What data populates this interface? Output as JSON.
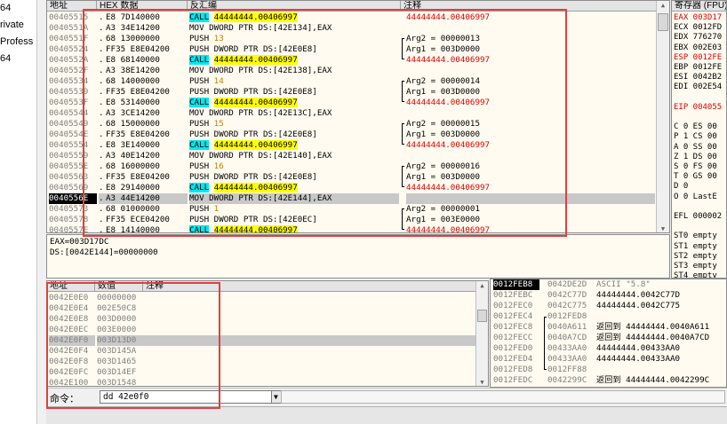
{
  "left_items": [
    "64",
    "rivate",
    "Profess",
    "64"
  ],
  "cpu_headers": {
    "address": "地址",
    "hex": "HEX 数据",
    "disasm": "反汇编",
    "comment": "注释"
  },
  "cpu_rows": [
    {
      "addr": "00405515",
      "dot": ".",
      "hex": "E8 7D140000",
      "disasm": [
        {
          "t": "CALL",
          "c": "call"
        },
        {
          "t": " "
        },
        {
          "t": "44444444.00406997",
          "c": "target"
        }
      ],
      "comment": [
        {
          "t": "44444444.00406997",
          "c": "red"
        }
      ]
    },
    {
      "addr": "0040551A",
      "dot": ".",
      "hex": "A3 34E14200",
      "disasm": [
        {
          "t": "MOV DWORD PTR DS:[42E134],EAX"
        }
      ],
      "comment": []
    },
    {
      "addr": "0040551F",
      "dot": ".",
      "hex": "68 13000000",
      "disasm": [
        {
          "t": "PUSH "
        },
        {
          "t": "13",
          "c": "num"
        }
      ],
      "comment": [
        {
          "t": "Arg2 = 00000013"
        }
      ]
    },
    {
      "addr": "00405524",
      "dot": ".",
      "hex": "FF35 E8E04200",
      "disasm": [
        {
          "t": "PUSH DWORD PTR DS:[42E0E8]"
        }
      ],
      "comment": [
        {
          "t": "Arg1 = 003D0000"
        }
      ]
    },
    {
      "addr": "0040552A",
      "dot": ".",
      "hex": "E8 68140000",
      "disasm": [
        {
          "t": "CALL",
          "c": "call"
        },
        {
          "t": " "
        },
        {
          "t": "44444444.00406997",
          "c": "target"
        }
      ],
      "comment": [
        {
          "t": "44444444.00406997",
          "c": "red"
        }
      ]
    },
    {
      "addr": "0040552F",
      "dot": ".",
      "hex": "A3 38E14200",
      "disasm": [
        {
          "t": "MOV DWORD PTR DS:[42E138],EAX"
        }
      ],
      "comment": []
    },
    {
      "addr": "00405534",
      "dot": ".",
      "hex": "68 14000000",
      "disasm": [
        {
          "t": "PUSH "
        },
        {
          "t": "14",
          "c": "num"
        }
      ],
      "comment": [
        {
          "t": "Arg2 = 00000014"
        }
      ]
    },
    {
      "addr": "00405539",
      "dot": ".",
      "hex": "FF35 E8E04200",
      "disasm": [
        {
          "t": "PUSH DWORD PTR DS:[42E0E8]"
        }
      ],
      "comment": [
        {
          "t": "Arg1 = 003D0000"
        }
      ]
    },
    {
      "addr": "0040553F",
      "dot": ".",
      "hex": "E8 53140000",
      "disasm": [
        {
          "t": "CALL",
          "c": "call"
        },
        {
          "t": " "
        },
        {
          "t": "44444444.00406997",
          "c": "target"
        }
      ],
      "comment": [
        {
          "t": "44444444.00406997",
          "c": "red"
        }
      ]
    },
    {
      "addr": "00405544",
      "dot": ".",
      "hex": "A3 3CE14200",
      "disasm": [
        {
          "t": "MOV DWORD PTR DS:[42E13C],EAX"
        }
      ],
      "comment": []
    },
    {
      "addr": "00405549",
      "dot": ".",
      "hex": "68 15000000",
      "disasm": [
        {
          "t": "PUSH "
        },
        {
          "t": "15",
          "c": "num"
        }
      ],
      "comment": [
        {
          "t": "Arg2 = 00000015"
        }
      ]
    },
    {
      "addr": "0040554E",
      "dot": ".",
      "hex": "FF35 E8E04200",
      "disasm": [
        {
          "t": "PUSH DWORD PTR DS:[42E0E8]"
        }
      ],
      "comment": [
        {
          "t": "Arg1 = 003D0000"
        }
      ]
    },
    {
      "addr": "00405554",
      "dot": ".",
      "hex": "E8 3E140000",
      "disasm": [
        {
          "t": "CALL",
          "c": "call"
        },
        {
          "t": " "
        },
        {
          "t": "44444444.00406997",
          "c": "target"
        }
      ],
      "comment": [
        {
          "t": "44444444.00406997",
          "c": "red"
        }
      ]
    },
    {
      "addr": "00405559",
      "dot": ".",
      "hex": "A3 40E14200",
      "disasm": [
        {
          "t": "MOV DWORD PTR DS:[42E140],EAX"
        }
      ],
      "comment": []
    },
    {
      "addr": "0040555E",
      "dot": ".",
      "hex": "68 16000000",
      "disasm": [
        {
          "t": "PUSH "
        },
        {
          "t": "16",
          "c": "num"
        }
      ],
      "comment": [
        {
          "t": "Arg2 = 00000016"
        }
      ]
    },
    {
      "addr": "00405563",
      "dot": ".",
      "hex": "FF35 E8E04200",
      "disasm": [
        {
          "t": "PUSH DWORD PTR DS:[42E0E8]"
        }
      ],
      "comment": [
        {
          "t": "Arg1 = 003D0000"
        }
      ]
    },
    {
      "addr": "00405569",
      "dot": ".",
      "hex": "E8 29140000",
      "disasm": [
        {
          "t": "CALL",
          "c": "call"
        },
        {
          "t": " "
        },
        {
          "t": "44444444.00406997",
          "c": "target"
        }
      ],
      "comment": [
        {
          "t": "44444444.00406997",
          "c": "red"
        }
      ]
    },
    {
      "addr": "0040556E",
      "dot": ".",
      "hex": "A3 44E14200",
      "disasm": [
        {
          "t": "MOV DWORD PTR DS:[42E144],EAX"
        }
      ],
      "comment": [],
      "selected": true
    },
    {
      "addr": "00405573",
      "dot": ".",
      "hex": "68 01000000",
      "disasm": [
        {
          "t": "PUSH "
        },
        {
          "t": "1",
          "c": "num"
        }
      ],
      "comment": [
        {
          "t": "Arg2 = 00000001"
        }
      ]
    },
    {
      "addr": "00405578",
      "dot": ".",
      "hex": "FF35 ECE04200",
      "disasm": [
        {
          "t": "PUSH DWORD PTR DS:[42E0EC]"
        }
      ],
      "comment": [
        {
          "t": "Arg1 = 003E0000"
        }
      ]
    },
    {
      "addr": "0040557E",
      "dot": ".",
      "hex": "E8 14140000",
      "disasm": [
        {
          "t": "CALL",
          "c": "call"
        },
        {
          "t": " "
        },
        {
          "t": "44444444.00406997",
          "c": "target"
        }
      ],
      "comment": [
        {
          "t": "44444444.00406997",
          "c": "red"
        }
      ]
    }
  ],
  "info_lines": [
    "EAX=003D17DC",
    "DS:[0042E144]=00000000"
  ],
  "dump_headers": {
    "address": "地址",
    "value": "数值",
    "comment": "注释"
  },
  "dump_rows": [
    {
      "addr": "0042E0E0",
      "value": "00000000"
    },
    {
      "addr": "0042E0E4",
      "value": "002E50C8"
    },
    {
      "addr": "0042E0E8",
      "value": "003D0000"
    },
    {
      "addr": "0042E0EC",
      "value": "003E0000"
    },
    {
      "addr": "0042E0F0",
      "value": "003D13D0",
      "selected": true
    },
    {
      "addr": "0042E0F4",
      "value": "003D145A"
    },
    {
      "addr": "0042E0F8",
      "value": "003D1465"
    },
    {
      "addr": "0042E0FC",
      "value": "003D14EF"
    },
    {
      "addr": "0042E100",
      "value": "003D1548"
    }
  ],
  "command": {
    "label": "命令：",
    "value": "dd 42e0f0"
  },
  "stack_rows": [
    {
      "addr": "0012FEB8",
      "value": "0042DE2D",
      "comment": "ASCII \"5.8\"",
      "selected": true
    },
    {
      "addr": "0012FEBC",
      "value": "0042C77D",
      "comment": "44444444.0042C77D"
    },
    {
      "addr": "0012FEC0",
      "value": "0042C775",
      "comment": "44444444.0042C775"
    },
    {
      "addr": "0012FEC4",
      "value": "0012FED8",
      "comment": ""
    },
    {
      "addr": "0012FEC8",
      "value": "0040A611",
      "comment": "返回到 44444444.0040A611"
    },
    {
      "addr": "0012FECC",
      "value": "0040A7CD",
      "comment": "返回到 44444444.0040A7CD"
    },
    {
      "addr": "0012FED0",
      "value": "00433AA0",
      "comment": "44444444.00433AA0"
    },
    {
      "addr": "0012FED4",
      "value": "00433AA0",
      "comment": "44444444.00433AA0"
    },
    {
      "addr": "0012FED8",
      "value": "0012FF88",
      "comment": ""
    },
    {
      "addr": "0012FEDC",
      "value": "0042299C",
      "comment": "返回到 44444444.0042299C"
    }
  ],
  "registers": {
    "header": "寄存器 (FPU)",
    "lines": [
      {
        "t": "EAX 003D17",
        "hl": "EAX"
      },
      {
        "t": "ECX 0012FD"
      },
      {
        "t": "EDX 776270"
      },
      {
        "t": "EBX 002E03"
      },
      {
        "t": "ESP 0012FE",
        "hl": "ESP"
      },
      {
        "t": "EBP 0012FE"
      },
      {
        "t": "ESI 0042B2"
      },
      {
        "t": "EDI 002E54"
      },
      {
        "t": ""
      },
      {
        "t": "EIP 004055",
        "hl": "EIP"
      },
      {
        "t": ""
      },
      {
        "t": "C 0  ES 00"
      },
      {
        "t": "P 1  CS 00"
      },
      {
        "t": "A 0  SS 00"
      },
      {
        "t": "Z 1  DS 00"
      },
      {
        "t": "S 0  FS 00"
      },
      {
        "t": "T 0  GS 00"
      },
      {
        "t": "D 0"
      },
      {
        "t": "O 0  LastE"
      },
      {
        "t": ""
      },
      {
        "t": "EFL 000002"
      },
      {
        "t": ""
      },
      {
        "t": "ST0 empty"
      },
      {
        "t": "ST1 empty"
      },
      {
        "t": "ST2 empty"
      },
      {
        "t": "ST3 empty"
      },
      {
        "t": "ST4 empty"
      }
    ]
  },
  "colors": {
    "call_bg": "#00e8f0",
    "target_bg": "#ffff00",
    "annotation": "#e04040",
    "comment_red": "#e00000",
    "number": "#c08000"
  }
}
